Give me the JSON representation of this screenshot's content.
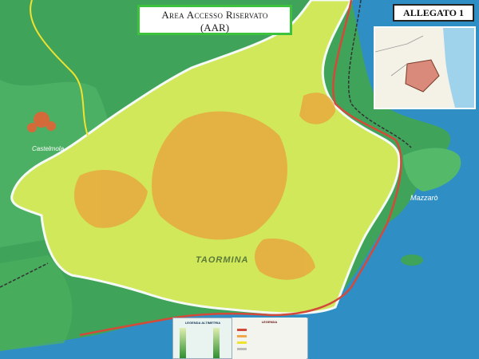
{
  "title": {
    "line1": "Area Accesso Riservato",
    "line2": "(AAR)"
  },
  "badge": "ALLEGATO 1",
  "places": {
    "taormina": "TAORMINA",
    "castelmola": "Castelmola",
    "mazzaro": "Mazzarò"
  },
  "legend": {
    "altimetria_title": "LEGENDA ALTIMETRIA",
    "legenda_title": "LEGENDA"
  },
  "colors": {
    "sea": "#2f8fc4",
    "land": "#3fa45a",
    "zone": "#d9ec5a",
    "border": "#ffffff"
  }
}
